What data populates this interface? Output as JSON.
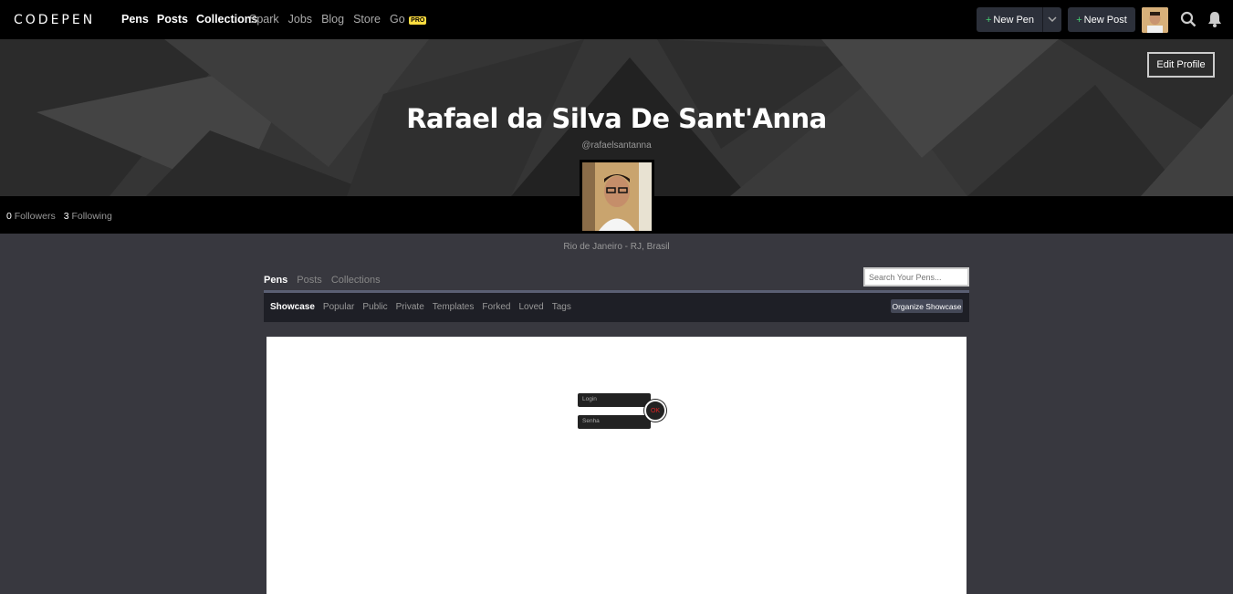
{
  "topbar": {
    "logo_text": "CODEPEN",
    "primary_nav": [
      "Pens",
      "Posts",
      "Collections"
    ],
    "secondary_nav": [
      "Spark",
      "Jobs",
      "Blog",
      "Store",
      "Go"
    ],
    "pro_badge": "PRO",
    "new_pen_label": "New Pen",
    "new_post_label": "New Post",
    "plus": "+"
  },
  "profile": {
    "edit_label": "Edit Profile",
    "name": "Rafael da Silva De Sant'Anna",
    "handle": "@rafaelsantanna",
    "followers_count": "0",
    "followers_label": "Followers",
    "following_count": "3",
    "following_label": "Following",
    "location": "Rio de Janeiro - RJ, Brasil"
  },
  "content_tabs": [
    "Pens",
    "Posts",
    "Collections"
  ],
  "search": {
    "placeholder": "Search Your Pens..."
  },
  "sub_tabs": [
    "Showcase",
    "Popular",
    "Public",
    "Private",
    "Templates",
    "Forked",
    "Loved",
    "Tags"
  ],
  "organize_label": "Organize Showcase",
  "preview": {
    "login_placeholder": "Login",
    "senha_placeholder": "Senha",
    "ok_label": "OK"
  },
  "colors": {
    "accent_green": "#47cf73",
    "pro_yellow": "#ffdd40"
  }
}
